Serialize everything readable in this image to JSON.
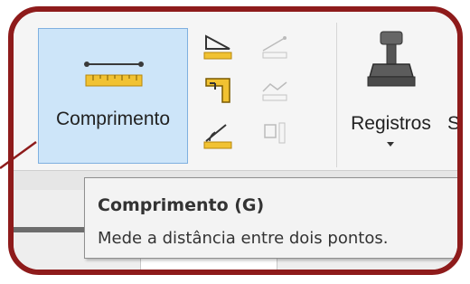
{
  "ribbon": {
    "measure_button": {
      "label": "Comprimento",
      "icon": "ruler-length-icon"
    },
    "small_tools": [
      {
        "icon": "angle-measure-icon",
        "enabled": true
      },
      {
        "icon": "corner-measure-icon",
        "enabled": true
      },
      {
        "icon": "protractor-icon",
        "enabled": true
      },
      {
        "icon": "line-measure-disabled-icon",
        "enabled": false
      },
      {
        "icon": "path-measure-disabled-icon",
        "enabled": false
      },
      {
        "icon": "object-measure-disabled-icon",
        "enabled": false
      }
    ],
    "registros_button": {
      "label": "Registros",
      "icon": "stamp-icon"
    },
    "cut_label": "S"
  },
  "tooltip": {
    "title": "Comprimento (G)",
    "description": "Mede a distância entre dois pontos."
  },
  "colors": {
    "frame_border": "#8e1b1b",
    "selected_button_bg": "#cde5f9",
    "selected_button_border": "#7fb0e0",
    "ruler_yellow": "#f1c232"
  }
}
